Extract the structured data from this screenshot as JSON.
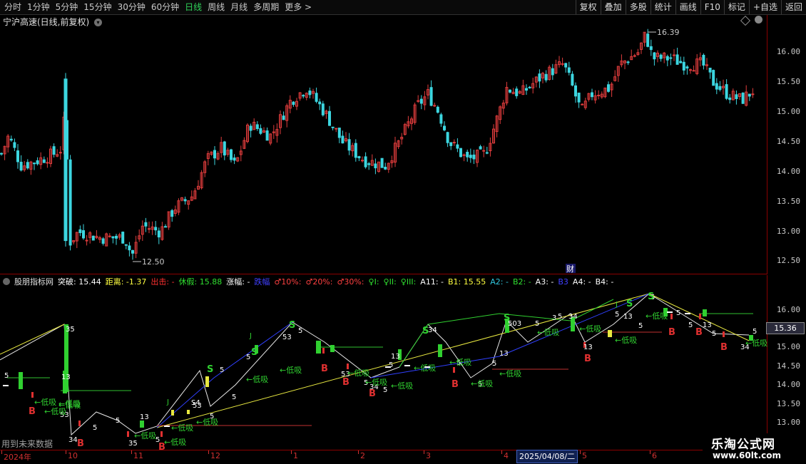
{
  "toolbar": {
    "periods": [
      "分时",
      "1分钟",
      "5分钟",
      "15分钟",
      "30分钟",
      "60分钟",
      "日线",
      "周线",
      "月线",
      "多周期",
      "更多"
    ],
    "active_period": "日线",
    "more_arrow": ">",
    "buttons": [
      "复权",
      "叠加",
      "多股",
      "统计",
      "画线",
      "F10",
      "标记",
      "+自选",
      "返回"
    ]
  },
  "main_panel": {
    "title": "宁沪高速(日线,前复权)",
    "y_ticks": [
      "16.00",
      "15.50",
      "15.00",
      "14.50",
      "14.00",
      "13.50",
      "13.00",
      "12.50"
    ],
    "high_annotation": "16.39",
    "low_annotation": "12.50",
    "finance_marker": "财",
    "up_color": "#e03c3c",
    "down_color": "#3cd6e0"
  },
  "indicator_panel": {
    "name": "股朋指标网",
    "fields": [
      {
        "label": "突破:",
        "value": "15.44",
        "color": "#ffffff"
      },
      {
        "label": "距离:",
        "value": "-1.37",
        "color": "#ffff40"
      },
      {
        "label": "出击:",
        "value": "-",
        "color": "#ff3030"
      },
      {
        "label": "休假:",
        "value": "15.88",
        "color": "#30e030"
      },
      {
        "label": "涨幅:",
        "value": "-",
        "color": "#ffffff"
      },
      {
        "label": "跌幅",
        "value": "",
        "color": "#4040ff"
      },
      {
        "label": "♂10%:",
        "value": "",
        "color": "#ff4040"
      },
      {
        "label": "♂20%:",
        "value": "",
        "color": "#ff4040"
      },
      {
        "label": "♂30%:",
        "value": "",
        "color": "#ff4040"
      },
      {
        "label": "♀I:",
        "value": "",
        "color": "#30e030"
      },
      {
        "label": "♀II:",
        "value": "",
        "color": "#30e030"
      },
      {
        "label": "♀III:",
        "value": "",
        "color": "#30e030"
      },
      {
        "label": "A11:",
        "value": "-",
        "color": "#ffffff"
      },
      {
        "label": "B1:",
        "value": "15.55",
        "color": "#ffff40"
      },
      {
        "label": "A2:",
        "value": "-",
        "color": "#30c8e0"
      },
      {
        "label": "B2:",
        "value": "-",
        "color": "#30e030"
      },
      {
        "label": "A3:",
        "value": "-",
        "color": "#ffffff"
      },
      {
        "label": "B3",
        "value": "",
        "color": "#4040ff"
      },
      {
        "label": "A4:",
        "value": "-",
        "color": "#ffffff"
      },
      {
        "label": "B4:",
        "value": "-",
        "color": "#ffffff"
      }
    ],
    "y_ticks": [
      "16.00",
      "15.50",
      "15.00",
      "14.50",
      "14.00",
      "13.50",
      "13.00"
    ],
    "current_value": "15.36",
    "bottom_note": "用到未来数据",
    "signal_buy": "B",
    "signal_sell": "S",
    "signal_low": "←低吸"
  },
  "date_axis": {
    "labels": [
      "2024年",
      "10",
      "11",
      "12",
      "1",
      "2",
      "3",
      "4",
      "5",
      "6"
    ],
    "cursor_date": "2025/04/08/二"
  },
  "watermark": {
    "site": "乐淘公式网",
    "url": "www.60lt.com"
  }
}
